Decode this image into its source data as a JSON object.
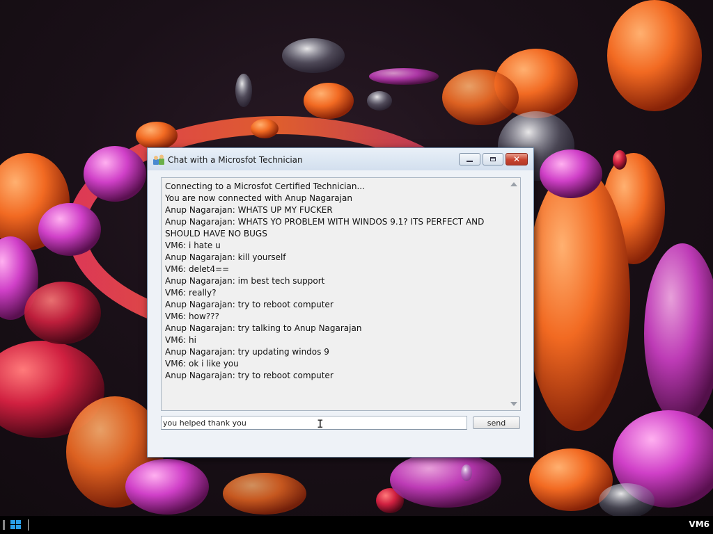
{
  "window": {
    "title": "Chat with a Microsfot Technician",
    "icon": "chat-users-icon"
  },
  "chat": {
    "lines": [
      "Connecting to a Microsfot Certified Technician...",
      "You are now connected with Anup Nagarajan",
      "Anup Nagarajan: WHATS UP MY FUCKER",
      "Anup Nagarajan: WHATS YO PROBLEM WITH WINDOS 9.1? ITS PERFECT AND SHOULD HAVE NO BUGS",
      "VM6: i hate u",
      "Anup Nagarajan: kill yourself",
      "VM6: delet4==",
      "Anup Nagarajan: im best tech support",
      "VM6: really?",
      "Anup Nagarajan: try to reboot computer",
      "VM6: how???",
      "Anup Nagarajan: try talking to Anup Nagarajan",
      "VM6: hi",
      "Anup Nagarajan: try updating windos 9",
      "VM6: ok i like you",
      "Anup Nagarajan: try to reboot computer"
    ]
  },
  "input": {
    "value": "you helped thank you",
    "send_label": "send"
  },
  "taskbar": {
    "start_icon": "windows-logo-icon",
    "vm_label": "VM6"
  },
  "colors": {
    "titlebar": "#dbe6f2",
    "close_button": "#c8432f",
    "taskbar": "#000000",
    "start_logo": "#2a9fe8"
  }
}
